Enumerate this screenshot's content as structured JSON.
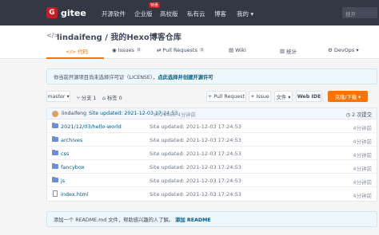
{
  "nav": {
    "logo_mark": "G",
    "logo_text": "gitee",
    "items": [
      "开源软件",
      "企业版",
      "高校版",
      "私有云",
      "博客",
      "我的 ▾"
    ],
    "badge": "特惠",
    "search_placeholder": "搜开"
  },
  "repo": {
    "icon": "</>",
    "title": "lindaifeng / 我的Hexo博客仓库",
    "sub_icon": "◎"
  },
  "tabs": [
    {
      "label": "</> 代码",
      "count": ""
    },
    {
      "label": "Issues",
      "count": "0"
    },
    {
      "label": "Pull Requests",
      "count": "0"
    },
    {
      "label": "Wiki",
      "count": ""
    },
    {
      "label": "统计",
      "count": ""
    },
    {
      "label": "DevOps ▾",
      "count": ""
    }
  ],
  "notice": {
    "text": "你当前开源项目尚未选择许可证（LICENSE），",
    "link": "点此选择并创建开源许可"
  },
  "toolbar": {
    "branch": "master ▾",
    "branches": "分支 1",
    "tags": "标签 0",
    "pull_request": "+ Pull Request",
    "issue": "+ Issue",
    "file": "文件 ▾",
    "webide": "Web IDE",
    "clone": "克隆/下载 ▾"
  },
  "commit": {
    "user": "lindaifeng",
    "message": "Site updated: 2021-12-03 17:24:53",
    "hash": "87294e6",
    "time": "4分钟前",
    "count": "2 次提交"
  },
  "files": [
    {
      "name": "2021/12/03/hello-world",
      "type": "folder",
      "message": "Site updated: 2021-12-03 17:24:53",
      "time": "4分钟前"
    },
    {
      "name": "archives",
      "type": "folder",
      "message": "Site updated: 2021-12-03 17:24:53",
      "time": "4分钟前"
    },
    {
      "name": "css",
      "type": "folder",
      "message": "Site updated: 2021-12-03 17:24:53",
      "time": "4分钟前"
    },
    {
      "name": "fancybox",
      "type": "folder",
      "message": "Site updated: 2021-12-03 17:24:53",
      "time": "4分钟前"
    },
    {
      "name": "js",
      "type": "folder",
      "message": "Site updated: 2021-12-03 17:24:53",
      "time": "4分钟前"
    },
    {
      "name": "index.html",
      "type": "file",
      "message": "Site updated: 2021-12-03 17:24:53",
      "time": "4分钟前"
    }
  ],
  "readme": {
    "text": "添加一个 README.md 文件，帮助感兴趣的人了解。",
    "link": "添加 README"
  },
  "colors": {
    "accent": "#fe7300",
    "nav_bg": "#333844",
    "link": "#005980",
    "brand": "#c71d23"
  }
}
